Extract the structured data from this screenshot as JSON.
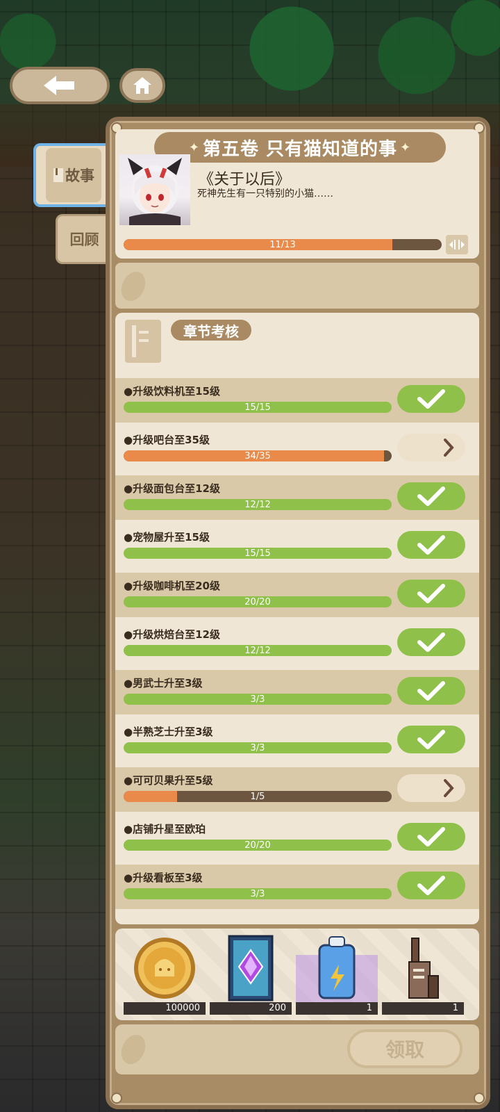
{
  "volume_title": "第五卷 只有猫知道的事",
  "side_tabs": {
    "story": "故事",
    "review": "回顾"
  },
  "story": {
    "title": "《关于以后》",
    "subtitle": "死神先生有一只特别的小猫……",
    "progress_text": "11/13",
    "progress_fraction": 0.846
  },
  "exam": {
    "title": "章节考核",
    "tasks": [
      {
        "label": "●升级饮料机至15级",
        "progress": "15/15",
        "fraction": 1.0,
        "status": "done"
      },
      {
        "label": "●升级吧台至35级",
        "progress": "34/35",
        "fraction": 0.971,
        "status": "go"
      },
      {
        "label": "●升级面包台至12级",
        "progress": "12/12",
        "fraction": 1.0,
        "status": "done"
      },
      {
        "label": "●宠物屋升至15级",
        "progress": "15/15",
        "fraction": 1.0,
        "status": "done"
      },
      {
        "label": "●升级咖啡机至20级",
        "progress": "20/20",
        "fraction": 1.0,
        "status": "done"
      },
      {
        "label": "●升级烘焙台至12级",
        "progress": "12/12",
        "fraction": 1.0,
        "status": "done"
      },
      {
        "label": "●男武士升至3级",
        "progress": "3/3",
        "fraction": 1.0,
        "status": "done"
      },
      {
        "label": "●半熟芝士升至3级",
        "progress": "3/3",
        "fraction": 1.0,
        "status": "done"
      },
      {
        "label": "●可可贝果升至5级",
        "progress": "1/5",
        "fraction": 0.2,
        "status": "go"
      },
      {
        "label": "●店铺升星至欧珀",
        "progress": "20/20",
        "fraction": 1.0,
        "status": "done"
      },
      {
        "label": "●升级看板至3级",
        "progress": "3/3",
        "fraction": 1.0,
        "status": "done"
      }
    ]
  },
  "rewards": [
    {
      "icon": "gold-coin-icon",
      "qty": "100000"
    },
    {
      "icon": "purple-gem-card-icon",
      "qty": "200"
    },
    {
      "icon": "energy-drink-icon",
      "qty": "1"
    },
    {
      "icon": "furniture-decor-icon",
      "qty": "1"
    }
  ],
  "claim_label": "领取",
  "colors": {
    "progress_done": "#8fc04a",
    "progress_partial": "#e98a4a",
    "bar_track": "#6d5640",
    "panel": "#a78c66"
  }
}
